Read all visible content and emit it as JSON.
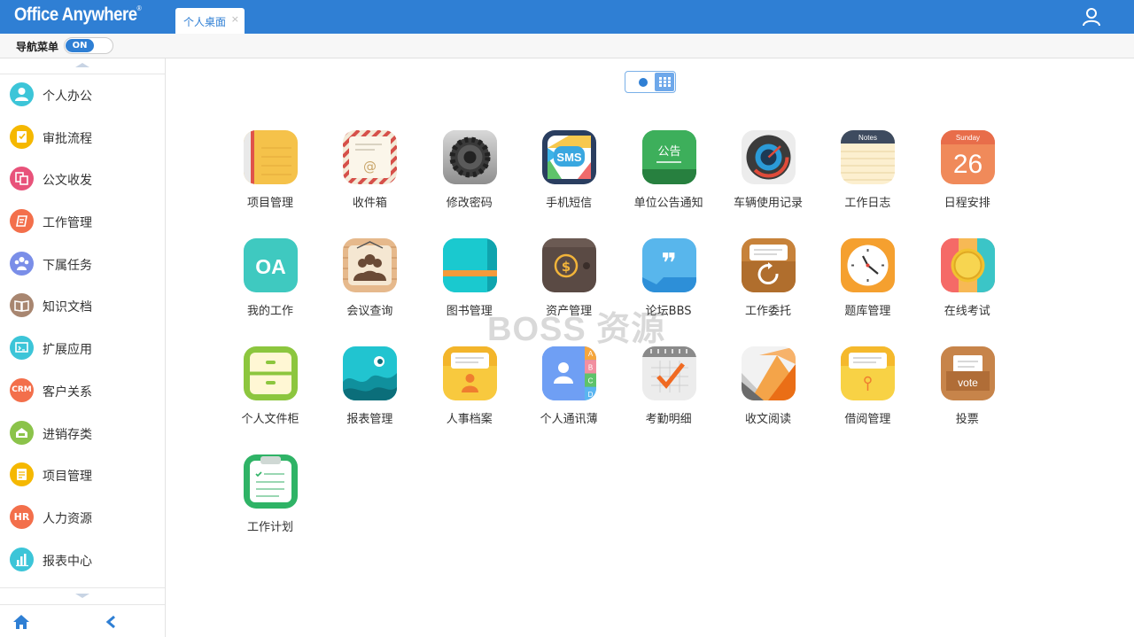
{
  "app": {
    "logo": "Office Anywhere",
    "logo_mark": "®"
  },
  "tabs": [
    {
      "label": "个人桌面",
      "close": "×"
    }
  ],
  "navbar": {
    "label": "导航菜单",
    "toggle": "ON"
  },
  "sidebar": {
    "items": [
      {
        "label": "个人办公",
        "icon": "person-icon",
        "color": "#3cc5d8",
        "glyph": ""
      },
      {
        "label": "审批流程",
        "icon": "approval-icon",
        "color": "#f5b800",
        "glyph": ""
      },
      {
        "label": "公文收发",
        "icon": "document-icon",
        "color": "#e8527a",
        "glyph": ""
      },
      {
        "label": "工作管理",
        "icon": "work-icon",
        "color": "#f36f4b",
        "glyph": ""
      },
      {
        "label": "下属任务",
        "icon": "team-icon",
        "color": "#7a8ee8",
        "glyph": ""
      },
      {
        "label": "知识文档",
        "icon": "book-icon",
        "color": "#a88670",
        "glyph": ""
      },
      {
        "label": "扩展应用",
        "icon": "extension-icon",
        "color": "#3cc5d8",
        "glyph": ""
      },
      {
        "label": "客户关系",
        "icon": "crm-icon",
        "color": "#f36f4b",
        "glyph": "CRM"
      },
      {
        "label": "进销存类",
        "icon": "inventory-icon",
        "color": "#8bc34a",
        "glyph": ""
      },
      {
        "label": "项目管理",
        "icon": "project-icon",
        "color": "#f5b800",
        "glyph": ""
      },
      {
        "label": "人力资源",
        "icon": "hr-icon",
        "color": "#f36f4b",
        "glyph": "HR"
      },
      {
        "label": "报表中心",
        "icon": "report-icon",
        "color": "#3cc5d8",
        "glyph": ""
      }
    ]
  },
  "apps": [
    {
      "label": "项目管理",
      "icon": "notebook-icon"
    },
    {
      "label": "收件箱",
      "icon": "envelope-icon"
    },
    {
      "label": "修改密码",
      "icon": "gear-icon"
    },
    {
      "label": "手机短信",
      "icon": "sms-icon",
      "text": "SMS"
    },
    {
      "label": "单位公告通知",
      "icon": "chalkboard-icon",
      "text": "公告"
    },
    {
      "label": "车辆使用记录",
      "icon": "speedometer-icon"
    },
    {
      "label": "工作日志",
      "icon": "notes-icon",
      "text": "Notes"
    },
    {
      "label": "日程安排",
      "icon": "calendar-icon",
      "text": "Sunday",
      "number": "26"
    },
    {
      "label": "我的工作",
      "icon": "oa-icon",
      "text": "OA"
    },
    {
      "label": "会议查询",
      "icon": "meeting-icon"
    },
    {
      "label": "图书管理",
      "icon": "book-icon"
    },
    {
      "label": "资产管理",
      "icon": "wallet-icon",
      "text": "$"
    },
    {
      "label": "论坛BBS",
      "icon": "quote-icon",
      "text": "❞"
    },
    {
      "label": "工作委托",
      "icon": "delegate-icon"
    },
    {
      "label": "题库管理",
      "icon": "clock-icon"
    },
    {
      "label": "在线考试",
      "icon": "medal-icon"
    },
    {
      "label": "个人文件柜",
      "icon": "cabinet-icon"
    },
    {
      "label": "报表管理",
      "icon": "chart-wave-icon"
    },
    {
      "label": "人事档案",
      "icon": "personnel-folder-icon"
    },
    {
      "label": "个人通讯薄",
      "icon": "address-book-icon",
      "letters": [
        "A",
        "B",
        "C",
        "D"
      ]
    },
    {
      "label": "考勤明细",
      "icon": "attendance-icon"
    },
    {
      "label": "收文阅读",
      "icon": "reading-icon"
    },
    {
      "label": "借阅管理",
      "icon": "borrow-folder-icon"
    },
    {
      "label": "投票",
      "icon": "vote-icon",
      "text": "vote"
    },
    {
      "label": "工作计划",
      "icon": "clipboard-icon"
    }
  ],
  "watermark": "BOSS 资源",
  "colors": {
    "primary": "#2f7fd4"
  }
}
